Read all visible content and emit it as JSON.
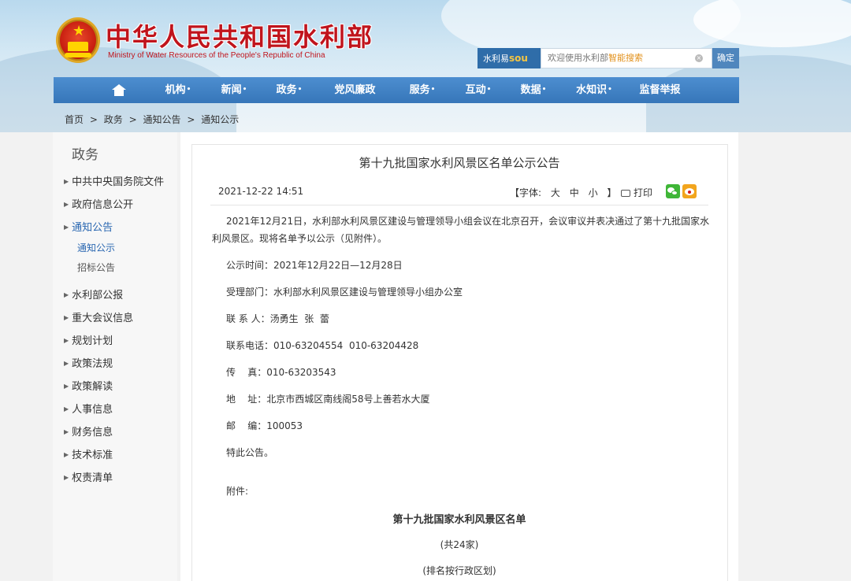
{
  "header": {
    "site_title": "中华人民共和国水利部",
    "site_subtitle": "Ministry of Water Resources of the People's Republic of China",
    "search": {
      "label_prefix": "水利易",
      "label_sou": "sou",
      "placeholder_prefix": "欢迎使用水利部",
      "placeholder_highlight": "智能搜索",
      "button": "确定"
    }
  },
  "nav": {
    "items": [
      {
        "label": "机构",
        "dot": "•"
      },
      {
        "label": "新闻",
        "dot": "•"
      },
      {
        "label": "政务",
        "dot": "•"
      },
      {
        "label": "党风廉政",
        "dot": ""
      },
      {
        "label": "服务",
        "dot": "•"
      },
      {
        "label": "互动",
        "dot": "•"
      },
      {
        "label": "数据",
        "dot": "•"
      },
      {
        "label": "水知识",
        "dot": "•"
      },
      {
        "label": "监督举报",
        "dot": ""
      }
    ]
  },
  "breadcrumb": [
    "首页",
    ">",
    "政务",
    ">",
    "通知公告",
    ">",
    "通知公示"
  ],
  "sidebar": {
    "title": "政务",
    "items": [
      "中共中央国务院文件",
      "政府信息公开",
      "通知公告",
      "水利部公报",
      "重大会议信息",
      "规划计划",
      "政策法规",
      "政策解读",
      "人事信息",
      "财务信息",
      "技术标准",
      "权责清单"
    ],
    "subitems": [
      "通知公示",
      "招标公告"
    ]
  },
  "article": {
    "title": "第十九批国家水利风景区名单公示公告",
    "date": "2021-12-22 14:51",
    "font_label": "【字体:",
    "font_large": "大",
    "font_medium": "中",
    "font_small": "小",
    "font_close": "】",
    "print": "打印",
    "intro": "2021年12月21日，水利部水利风景区建设与管理领导小组会议在北京召开，会议审议并表决通过了第十九批国家水利风景区。现将名单予以公示（见附件）。",
    "lines": [
      "公示时间：2021年12月22日—12月28日",
      "受理部门：水利部水利风景区建设与管理领导小组办公室",
      "联 系 人：汤勇生  张  蕾",
      "联系电话：010-63204554  010-63204428",
      "传    真：010-63203543",
      "地    址：北京市西城区南线阁58号上善若水大厦",
      "邮    编：100053",
      "特此公告。"
    ],
    "attachment_label": "附件:",
    "list_title": "第十九批国家水利风景区名单",
    "list_count": "(共24家)",
    "list_order": "(排名按行政区划)"
  }
}
